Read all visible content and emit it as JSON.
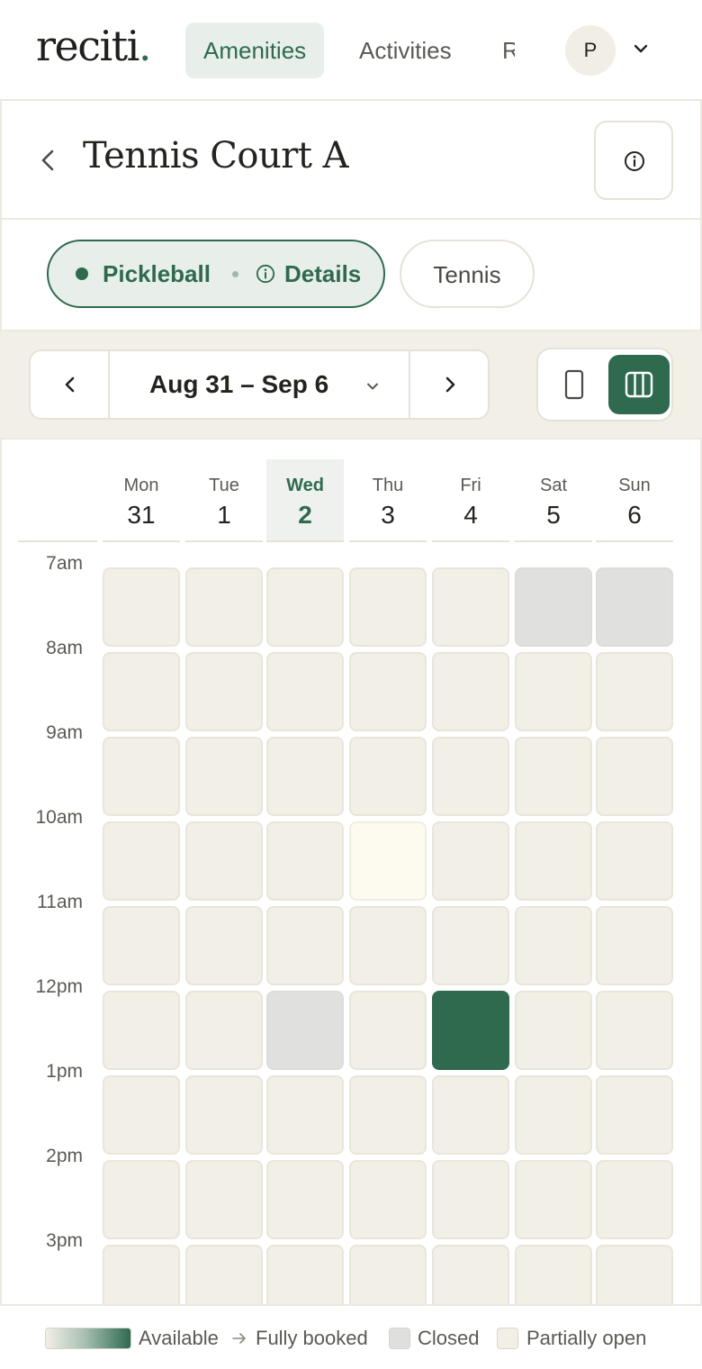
{
  "nav": {
    "logo": "reciti",
    "logo_dot": ".",
    "tabs": [
      {
        "label": "Amenities",
        "active": true
      },
      {
        "label": "Activities",
        "active": false
      },
      {
        "label": "R",
        "active": false
      }
    ],
    "avatar_initial": "P"
  },
  "page": {
    "title": "Tennis Court A"
  },
  "sports": {
    "active": {
      "label": "Pickleball",
      "details_label": "Details"
    },
    "inactive": {
      "label": "Tennis"
    }
  },
  "week": {
    "range": "Aug 31 – Sep 6"
  },
  "calendar": {
    "days": [
      {
        "name": "Mon",
        "num": "31",
        "today": false
      },
      {
        "name": "Tue",
        "num": "1",
        "today": false
      },
      {
        "name": "Wed",
        "num": "2",
        "today": true
      },
      {
        "name": "Thu",
        "num": "3",
        "today": false
      },
      {
        "name": "Fri",
        "num": "4",
        "today": false
      },
      {
        "name": "Sat",
        "num": "5",
        "today": false
      },
      {
        "name": "Sun",
        "num": "6",
        "today": false
      }
    ],
    "times": [
      "7am",
      "8am",
      "9am",
      "10am",
      "11am",
      "12pm",
      "1pm",
      "2pm",
      "3pm"
    ],
    "slot_status": [
      [
        "partial",
        "partial",
        "partial",
        "partial",
        "partial",
        "closed",
        "closed"
      ],
      [
        "partial",
        "partial",
        "partial",
        "partial",
        "partial",
        "partial",
        "partial"
      ],
      [
        "partial",
        "partial",
        "partial",
        "partial",
        "partial",
        "partial",
        "partial"
      ],
      [
        "partial",
        "partial",
        "partial",
        "available",
        "partial",
        "partial",
        "partial"
      ],
      [
        "partial",
        "partial",
        "partial",
        "partial",
        "partial",
        "partial",
        "partial"
      ],
      [
        "partial",
        "partial",
        "closed",
        "partial",
        "booked",
        "partial",
        "partial"
      ],
      [
        "partial",
        "partial",
        "partial",
        "partial",
        "partial",
        "partial",
        "partial"
      ],
      [
        "partial",
        "partial",
        "partial",
        "partial",
        "partial",
        "partial",
        "partial"
      ],
      [
        "partial",
        "partial",
        "partial",
        "partial",
        "partial",
        "partial",
        "partial"
      ]
    ]
  },
  "legend": {
    "available": "Available",
    "fully_booked": "Fully booked",
    "closed": "Closed",
    "partial": "Partially open"
  },
  "colors": {
    "accent": "#2f6a4f",
    "accent_light": "#e8efea",
    "slot_partial": "#f2efe6",
    "slot_closed": "#e0e1de",
    "toolbar_bg": "#f2efe6"
  },
  "icons": {
    "back": "chevron-left-icon",
    "info": "info-icon",
    "prev_week": "chevron-left-icon",
    "next_week": "chevron-right-icon",
    "range_dropdown": "chevron-down-icon",
    "day_view": "phone-outline-icon",
    "week_view": "columns-icon",
    "account_menu": "chevron-down-icon"
  }
}
